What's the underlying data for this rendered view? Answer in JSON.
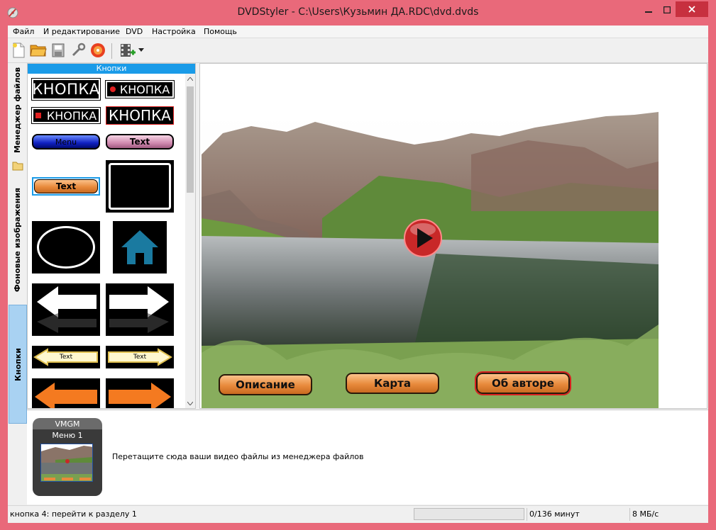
{
  "window": {
    "title": "DVDStyler - C:\\Users\\Кузьмин ДА.RDC\\dvd.dvds"
  },
  "menubar": {
    "items": [
      "Файл",
      "И редактирование",
      "DVD",
      "Настройка",
      "Помощь"
    ]
  },
  "toolbar": {
    "icons": [
      "new-file-icon",
      "open-folder-icon",
      "save-icon",
      "settings-wrench-icon",
      "burn-disc-icon",
      "add-video-icon"
    ]
  },
  "side_tabs": {
    "file_manager": "Менеджер файлов",
    "backgrounds": "Фоновые изображения",
    "buttons": "Кнопки"
  },
  "buttons_panel": {
    "header": "Кнопки",
    "tiles": {
      "knopka_plain": "КНОПКА",
      "knopka_dot": "КНОПКА",
      "knopka_square": "КНОПКА",
      "knopka_outline": "КНОПКА",
      "menu_blue": "Menu",
      "text_pink": "Text",
      "text_orange": "Text",
      "arrow_text_left": "Text",
      "arrow_text_right": "Text"
    }
  },
  "canvas": {
    "buttons": [
      "Описание",
      "Карта",
      "Об авторе"
    ],
    "selected_button_index": 2
  },
  "titleset": {
    "vmgm": "VMGM",
    "menu1": "Меню 1",
    "drop_hint": "Перетащите сюда ваши видео файлы из менеджера файлов"
  },
  "statusbar": {
    "message": "кнопка 4: перейти к разделу 1",
    "progress": 0,
    "duration": "0/136 минут",
    "speed": "8 МБ/с"
  },
  "colors": {
    "accent": "#1a9be8",
    "window_border": "#e9697a",
    "close": "#c7303f"
  }
}
